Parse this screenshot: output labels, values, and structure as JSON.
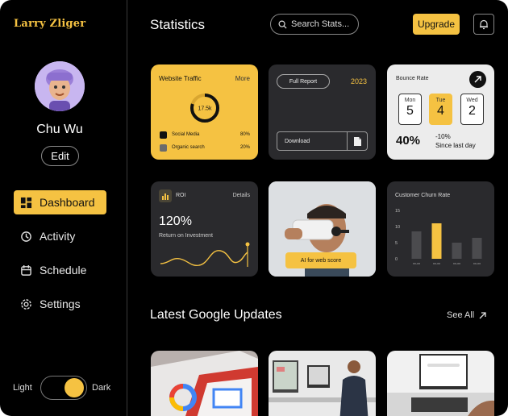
{
  "brand": "Larry Zliger",
  "user": {
    "name": "Chu Wu",
    "edit_label": "Edit"
  },
  "nav": [
    {
      "label": "Dashboard",
      "icon": "dashboard-icon",
      "active": true
    },
    {
      "label": "Activity",
      "icon": "activity-icon",
      "active": false
    },
    {
      "label": "Schedule",
      "icon": "calendar-icon",
      "active": false
    },
    {
      "label": "Settings",
      "icon": "gear-icon",
      "active": false
    }
  ],
  "theme": {
    "light_label": "Light",
    "dark_label": "Dark",
    "selected": "Dark"
  },
  "header": {
    "title": "Statistics",
    "search_placeholder": "Search Stats...",
    "upgrade_label": "Upgrade"
  },
  "cards": {
    "traffic": {
      "title": "Website Traffic",
      "more_label": "More",
      "center_value": "17.5k",
      "legend": [
        {
          "label": "Social Media",
          "value": "80%",
          "color": "#111111"
        },
        {
          "label": "Organic search",
          "value": "20%",
          "color": "#6b6b6b"
        }
      ]
    },
    "report": {
      "pill_label": "Full Report",
      "year": "2023",
      "download_label": "Download"
    },
    "bounce": {
      "title": "Bounce Rate",
      "days": [
        {
          "name": "Mon",
          "value": "5"
        },
        {
          "name": "Tue",
          "value": "4"
        },
        {
          "name": "Wed",
          "value": "2"
        }
      ],
      "rate": "40%",
      "change": "-10%",
      "change_caption": "Since last day"
    },
    "roi": {
      "title": "ROI",
      "details_label": "Details",
      "value": "120%",
      "subtitle": "Return on Investment"
    },
    "photo": {
      "button_label": "AI for web score"
    },
    "churn": {
      "title": "Customer Churn Rate"
    }
  },
  "chart_data": {
    "type": "bar",
    "title": "Customer Churn Rate",
    "categories": [
      "xx-xx",
      "xx-xx",
      "xx-xx",
      "xx-xx"
    ],
    "values": [
      8.5,
      11,
      5,
      6.5
    ],
    "highlight_index": 1,
    "ylim": [
      0,
      15
    ],
    "yticks": [
      15,
      10,
      5,
      0
    ],
    "colors": {
      "bar": "#4b4b4e",
      "highlight": "#F5C242"
    }
  },
  "updates": {
    "title": "Latest Google Updates",
    "see_all_label": "See All"
  },
  "colors": {
    "accent": "#F5C242",
    "background": "#000000",
    "card": "#2A2A2D"
  }
}
